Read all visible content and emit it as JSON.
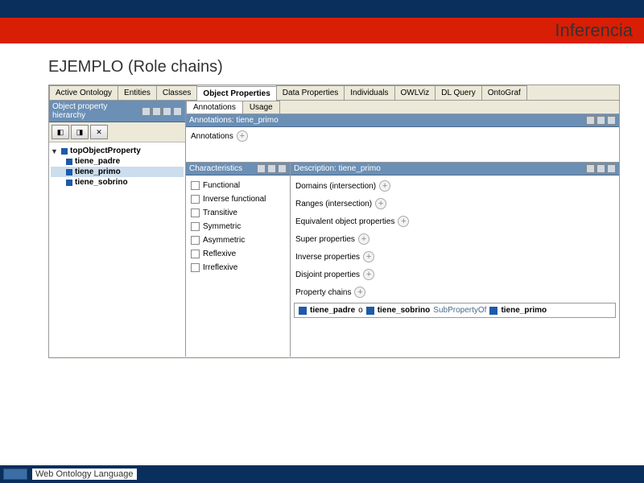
{
  "header": {
    "title": "Inferencia"
  },
  "subtitle": "EJEMPLO (Role chains)",
  "tabs": [
    "Active Ontology",
    "Entities",
    "Classes",
    "Object Properties",
    "Data Properties",
    "Individuals",
    "OWLViz",
    "DL Query",
    "OntoGraf"
  ],
  "active_tab": "Object Properties",
  "left": {
    "panel_title": "Object property hierarchy",
    "tree_root": "topObjectProperty",
    "children": [
      "tiene_padre",
      "tiene_primo",
      "tiene_sobrino"
    ],
    "selected": "tiene_primo"
  },
  "right": {
    "inner_tabs": [
      "Annotations",
      "Usage"
    ],
    "annotations_header": "Annotations: tiene_primo",
    "annotations_label": "Annotations",
    "characteristics_header": "Characteristics",
    "characteristics": [
      "Functional",
      "Inverse functional",
      "Transitive",
      "Symmetric",
      "Asymmetric",
      "Reflexive",
      "Irreflexive"
    ],
    "description_header": "Description: tiene_primo",
    "desc_sections": {
      "domains": "Domains (intersection)",
      "ranges": "Ranges (intersection)",
      "equivalent": "Equivalent object properties",
      "super": "Super properties",
      "inverse": "Inverse properties",
      "disjoint": "Disjoint properties",
      "chains": "Property chains"
    },
    "chain": {
      "p1": "tiene_padre",
      "op": "o",
      "p2": "tiene_sobrino",
      "rel": "SubPropertyOf",
      "p3": "tiene_primo"
    }
  },
  "footer": {
    "text": "Web Ontology Language"
  }
}
